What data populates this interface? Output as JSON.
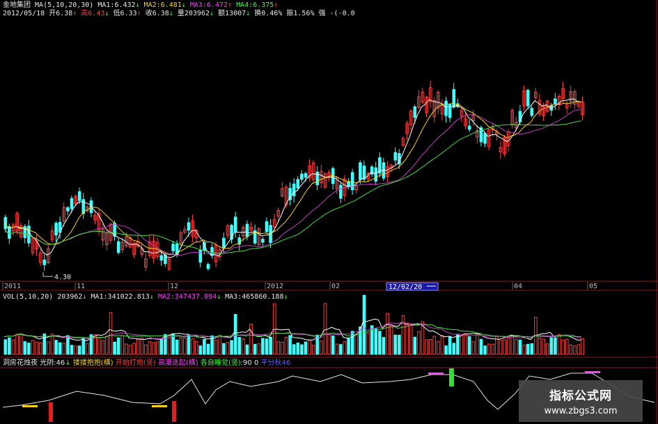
{
  "header": {
    "line1": {
      "stock_name": "金地集团",
      "ma_param": "MA(5,10,20,30)",
      "ma1": "MA1:6.432",
      "ma1_dir": "↓",
      "ma2": "MA2:6.481",
      "ma2_dir": "↓",
      "ma3": "MA3:6.472",
      "ma3_dir": "↑",
      "ma4": "MA4:6.375",
      "ma4_dir": "↑"
    },
    "line2": {
      "date": "2012/05/18",
      "open": "开6.38",
      "open_dir": "↑",
      "high": "高6.43",
      "high_dir": "↓",
      "low": "低6.33",
      "low_dir": "↑",
      "close": "收6.38",
      "close_dir": "↓",
      "volume": "量203962",
      "volume_dir": "↓",
      "amount": "额13007",
      "amount_dir": "↓",
      "turnover": "换0.46%",
      "amplitude": "振1.56%",
      "strength": "强 -(-0.0"
    }
  },
  "price_panel": {
    "low_marker": "4.30",
    "axis_labels": [
      "2011",
      "11",
      "12",
      "2012",
      "02",
      "04",
      "05"
    ],
    "cursor_date": "12/02/20"
  },
  "volume_panel": {
    "param": "VOL(5,10,20)",
    "vol": "203962",
    "vol_dir": "↓",
    "ma1": "MA1:341022.813",
    "ma1_dir": "↓",
    "ma2": "MA2:347437.094",
    "ma2_dir": "↓",
    "ma3": "MA3:465860.188",
    "ma3_dir": "↓"
  },
  "indicator_panel": {
    "name": "洞房花烛夜",
    "light": "光阴:46",
    "light_dir": "↓",
    "item1": "搂搂抱抱(横)",
    "item2": "开始打炮(竖)",
    "item3": "高潮迭起(横)",
    "item4": "各自睡觉(竖)",
    "item4_value": ":90",
    "item4_value2": "0",
    "item5": "平分秋",
    "item5_value": "46"
  },
  "watermark": {
    "title": "指标公式网",
    "url": "www.zbgs3.com"
  },
  "colors": {
    "up": "#ff4040",
    "down": "#40ffff",
    "ma1": "#ffffff",
    "ma2": "#ffd21e",
    "ma3": "#c040c0",
    "ma4": "#40e040",
    "background": "#000000"
  },
  "chart_data": [
    {
      "type": "candlestick",
      "period": "2011-10 to 2012-05",
      "approx_price_range": [
        4.3,
        7.2
      ],
      "low_marker_value": 4.3,
      "series": [
        {
          "name": "MA1",
          "value": 6.432
        },
        {
          "name": "MA2",
          "value": 6.481
        },
        {
          "name": "MA3",
          "value": 6.472
        },
        {
          "name": "MA4",
          "value": 6.375
        }
      ]
    },
    {
      "type": "bar",
      "name": "VOL",
      "latest_volume": 203962,
      "series": [
        {
          "name": "MA1",
          "value": 341022.813
        },
        {
          "name": "MA2",
          "value": 347437.094
        },
        {
          "name": "MA3",
          "value": 465860.188
        }
      ]
    },
    {
      "type": "line",
      "name": "洞房花烛夜",
      "latest_value": 46
    }
  ]
}
